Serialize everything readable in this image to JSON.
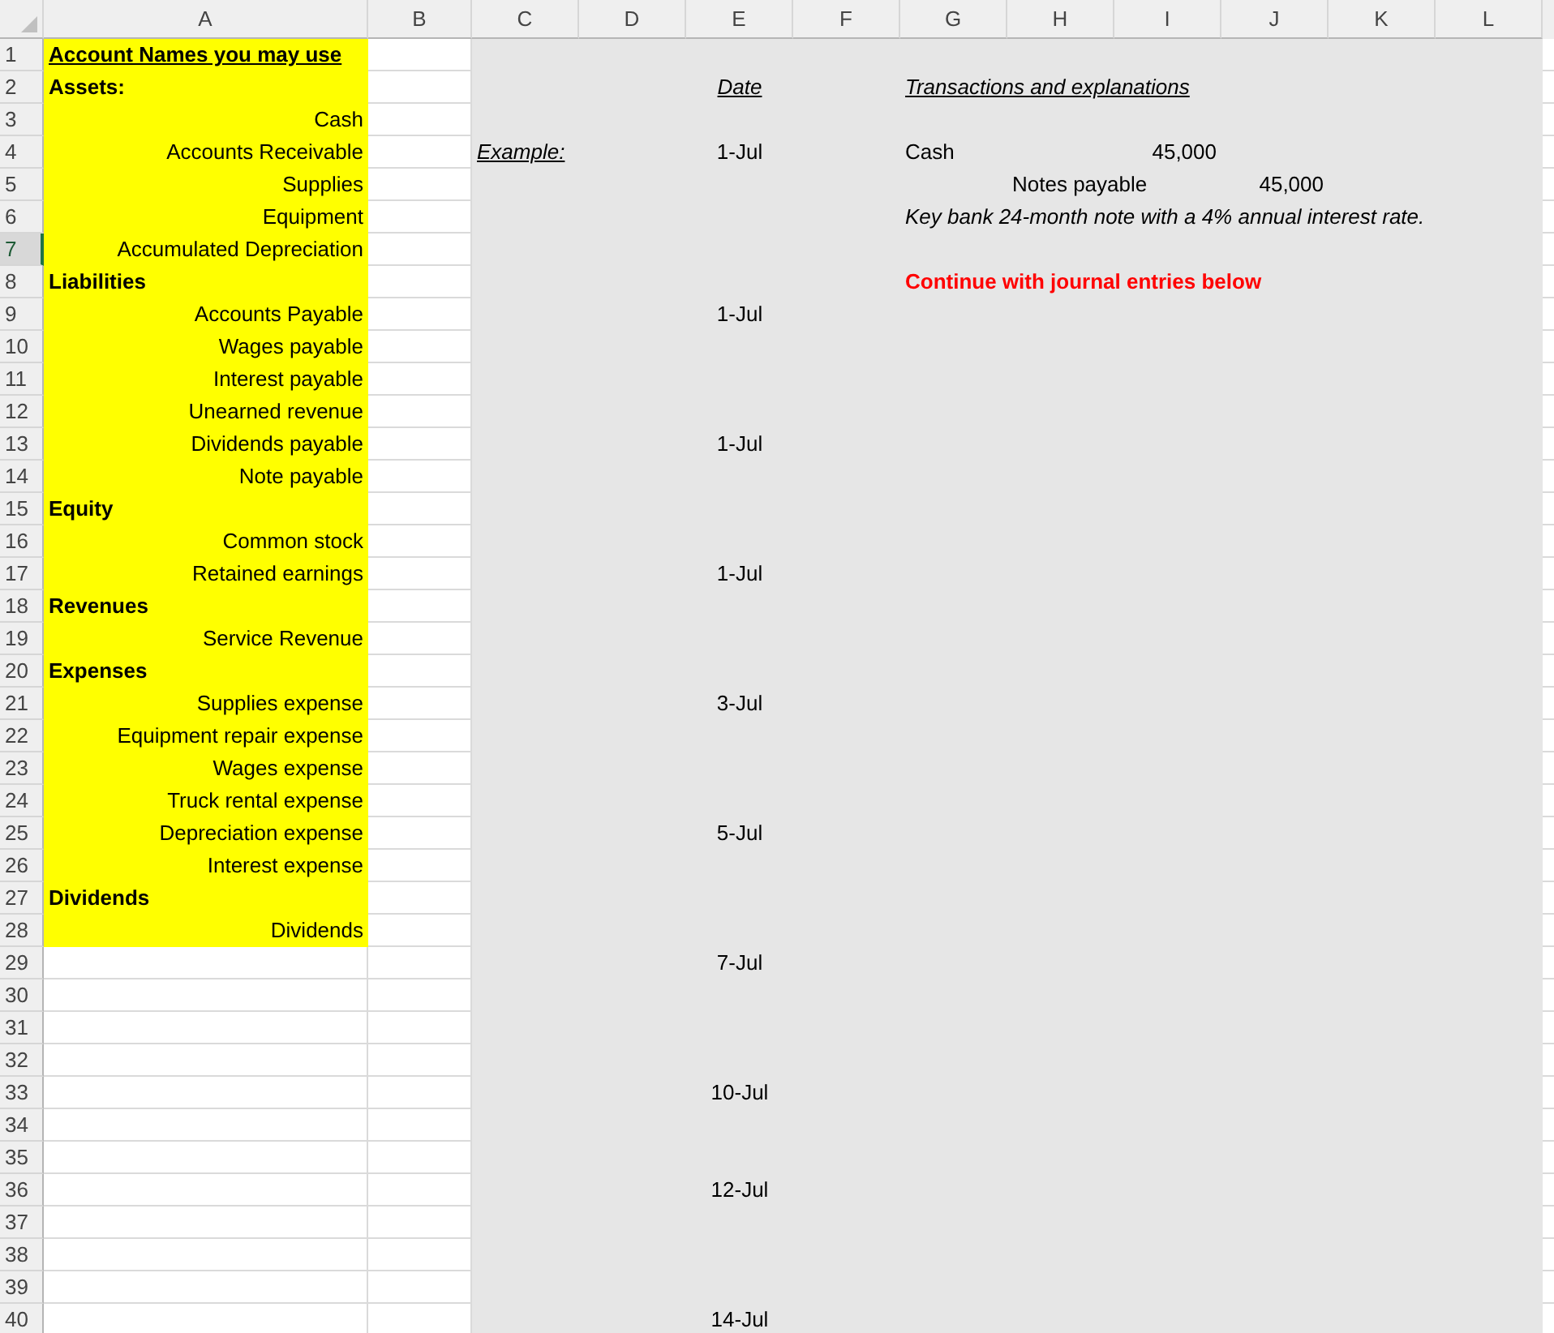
{
  "columns": [
    "A",
    "B",
    "C",
    "D",
    "E",
    "F",
    "G",
    "H",
    "I",
    "J",
    "K",
    "L"
  ],
  "rows": [
    {
      "number": "1",
      "selected": false,
      "highlighted": true,
      "a": {
        "text": "Account Names you may use",
        "kind": "heading"
      }
    },
    {
      "number": "2",
      "selected": false,
      "highlighted": true,
      "a": {
        "text": "Assets:",
        "kind": "category"
      },
      "e": {
        "text": "Date",
        "kind": "date-heading"
      },
      "g": {
        "text": "Transactions and explanations",
        "kind": "label"
      }
    },
    {
      "number": "3",
      "selected": false,
      "highlighted": true,
      "a": {
        "text": "Cash",
        "kind": "account"
      }
    },
    {
      "number": "4",
      "selected": false,
      "highlighted": true,
      "a": {
        "text": "Accounts Receivable",
        "kind": "account"
      },
      "c": {
        "text": "Example:",
        "kind": "label"
      },
      "e": {
        "text": "1-Jul",
        "kind": "date"
      },
      "g": {
        "text": "Cash",
        "kind": "entry"
      },
      "i": {
        "text": "45,000",
        "kind": "amount"
      }
    },
    {
      "number": "5",
      "selected": false,
      "highlighted": true,
      "a": {
        "text": "Supplies",
        "kind": "account"
      },
      "h": {
        "text": "Notes payable",
        "kind": "entry"
      },
      "j": {
        "text": "45,000",
        "kind": "amount"
      }
    },
    {
      "number": "6",
      "selected": false,
      "highlighted": true,
      "a": {
        "text": "Equipment",
        "kind": "account"
      },
      "g": {
        "text": "Key bank 24-month note with a 4% annual interest rate.",
        "kind": "note"
      }
    },
    {
      "number": "7",
      "selected": true,
      "highlighted": true,
      "a": {
        "text": "Accumulated Depreciation",
        "kind": "account"
      }
    },
    {
      "number": "8",
      "selected": false,
      "highlighted": true,
      "a": {
        "text": "Liabilities",
        "kind": "category"
      },
      "g": {
        "text": "Continue with journal entries below",
        "kind": "alert"
      }
    },
    {
      "number": "9",
      "selected": false,
      "highlighted": true,
      "a": {
        "text": "Accounts Payable",
        "kind": "account"
      },
      "e": {
        "text": "1-Jul",
        "kind": "date"
      }
    },
    {
      "number": "10",
      "selected": false,
      "highlighted": true,
      "a": {
        "text": "Wages payable",
        "kind": "account"
      }
    },
    {
      "number": "11",
      "selected": false,
      "highlighted": true,
      "a": {
        "text": "Interest payable",
        "kind": "account"
      }
    },
    {
      "number": "12",
      "selected": false,
      "highlighted": true,
      "a": {
        "text": "Unearned revenue",
        "kind": "account"
      }
    },
    {
      "number": "13",
      "selected": false,
      "highlighted": true,
      "a": {
        "text": "Dividends payable",
        "kind": "account"
      },
      "e": {
        "text": "1-Jul",
        "kind": "date"
      }
    },
    {
      "number": "14",
      "selected": false,
      "highlighted": true,
      "a": {
        "text": "Note payable",
        "kind": "account"
      }
    },
    {
      "number": "15",
      "selected": false,
      "highlighted": true,
      "a": {
        "text": "Equity",
        "kind": "category"
      }
    },
    {
      "number": "16",
      "selected": false,
      "highlighted": true,
      "a": {
        "text": "Common stock",
        "kind": "account"
      }
    },
    {
      "number": "17",
      "selected": false,
      "highlighted": true,
      "a": {
        "text": "Retained earnings",
        "kind": "account"
      },
      "e": {
        "text": "1-Jul",
        "kind": "date"
      }
    },
    {
      "number": "18",
      "selected": false,
      "highlighted": true,
      "a": {
        "text": "Revenues",
        "kind": "category"
      }
    },
    {
      "number": "19",
      "selected": false,
      "highlighted": true,
      "a": {
        "text": "Service Revenue",
        "kind": "account"
      }
    },
    {
      "number": "20",
      "selected": false,
      "highlighted": true,
      "a": {
        "text": "Expenses",
        "kind": "category"
      }
    },
    {
      "number": "21",
      "selected": false,
      "highlighted": true,
      "a": {
        "text": "Supplies expense",
        "kind": "account"
      },
      "e": {
        "text": "3-Jul",
        "kind": "date"
      }
    },
    {
      "number": "22",
      "selected": false,
      "highlighted": true,
      "a": {
        "text": "Equipment repair expense",
        "kind": "account"
      }
    },
    {
      "number": "23",
      "selected": false,
      "highlighted": true,
      "a": {
        "text": "Wages expense",
        "kind": "account"
      }
    },
    {
      "number": "24",
      "selected": false,
      "highlighted": true,
      "a": {
        "text": "Truck rental expense",
        "kind": "account"
      }
    },
    {
      "number": "25",
      "selected": false,
      "highlighted": true,
      "a": {
        "text": "Depreciation expense",
        "kind": "account"
      },
      "e": {
        "text": "5-Jul",
        "kind": "date"
      }
    },
    {
      "number": "26",
      "selected": false,
      "highlighted": true,
      "a": {
        "text": "Interest expense",
        "kind": "account"
      }
    },
    {
      "number": "27",
      "selected": false,
      "highlighted": true,
      "a": {
        "text": "Dividends",
        "kind": "category"
      }
    },
    {
      "number": "28",
      "selected": false,
      "highlighted": true,
      "a": {
        "text": "Dividends",
        "kind": "account"
      }
    },
    {
      "number": "29",
      "selected": false,
      "highlighted": false,
      "e": {
        "text": "7-Jul",
        "kind": "date"
      }
    },
    {
      "number": "30",
      "selected": false,
      "highlighted": false
    },
    {
      "number": "31",
      "selected": false,
      "highlighted": false
    },
    {
      "number": "32",
      "selected": false,
      "highlighted": false
    },
    {
      "number": "33",
      "selected": false,
      "highlighted": false,
      "e": {
        "text": "10-Jul",
        "kind": "date"
      }
    },
    {
      "number": "34",
      "selected": false,
      "highlighted": false
    },
    {
      "number": "35",
      "selected": false,
      "highlighted": false
    },
    {
      "number": "36",
      "selected": false,
      "highlighted": false,
      "e": {
        "text": "12-Jul",
        "kind": "date"
      }
    },
    {
      "number": "37",
      "selected": false,
      "highlighted": false
    },
    {
      "number": "38",
      "selected": false,
      "highlighted": false
    },
    {
      "number": "39",
      "selected": false,
      "highlighted": false
    },
    {
      "number": "40",
      "selected": false,
      "highlighted": false,
      "e": {
        "text": "14-Jul",
        "kind": "date"
      }
    }
  ]
}
